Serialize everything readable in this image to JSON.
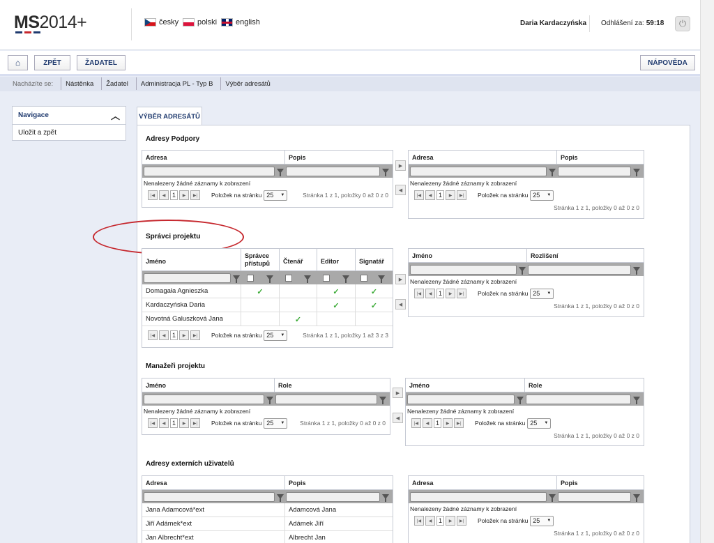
{
  "header": {
    "logo_main": "MS",
    "logo_rest": "2014+",
    "languages": [
      {
        "label": "česky",
        "flag": "cz"
      },
      {
        "label": "polski",
        "flag": "pl"
      },
      {
        "label": "english",
        "flag": "gb"
      }
    ],
    "user": "Daria Kardaczyńska",
    "logout_label": "Odhlášení za:",
    "logout_time": "59:18"
  },
  "toolbar": {
    "back": "ZPĚT",
    "applicant": "ŽADATEL",
    "help": "NÁPOVĚDA"
  },
  "breadcrumb": {
    "prefix": "Nacházíte se:",
    "items": [
      "Nástěnka",
      "Žadatel",
      "Administracja PL - Typ B",
      "Výběr adresátů"
    ]
  },
  "nav": {
    "title": "Navigace",
    "item": "Uložit a zpět"
  },
  "tab": "VÝBĚR ADRESÁTŮ",
  "common": {
    "no_records": "Nenalezeny žádné záznamy k zobrazení",
    "per_page": "Položek na stránku",
    "page_size": "25",
    "page": "1",
    "info_empty": "Stránka 1 z 1, položky 0 až 0 z 0",
    "info_three": "Stránka 1 z 1, položky 1 až 3 z 3"
  },
  "sec1": {
    "title": "Adresy Podpory",
    "col1": "Adresa",
    "col2": "Popis"
  },
  "sec2": {
    "title": "Správci projektu",
    "cols": {
      "name": "Jméno",
      "admin": "Správce přístupů",
      "reader": "Čtenář",
      "editor": "Editor",
      "signer": "Signatář"
    },
    "rows": [
      {
        "name": "Domagała Agnieszka",
        "admin": "✓",
        "reader": "",
        "editor": "✓",
        "signer": "✓"
      },
      {
        "name": "Kardaczyńska Daria",
        "admin": "",
        "reader": "",
        "editor": "✓",
        "signer": "✓"
      },
      {
        "name": "Novotná Galuszková Jana",
        "admin": "",
        "reader": "✓",
        "editor": "",
        "signer": ""
      }
    ],
    "right_col1": "Jméno",
    "right_col2": "Rozlišení"
  },
  "sec3": {
    "title": "Manažeři projektu",
    "col1": "Jméno",
    "col2": "Role"
  },
  "sec4": {
    "title": "Adresy externích uživatelů",
    "col1": "Adresa",
    "col2": "Popis",
    "rows": [
      {
        "a": "Jana Adamcová*ext",
        "b": "Adamcová Jana"
      },
      {
        "a": "Jiří Adámek*ext",
        "b": "Adámek Jiří"
      },
      {
        "a": "Jan Albrecht*ext",
        "b": "Albrecht Jan"
      }
    ]
  },
  "colors": {
    "accent": "#1f3a6e",
    "annotation": "#c6282e",
    "check": "#3aaa35"
  }
}
